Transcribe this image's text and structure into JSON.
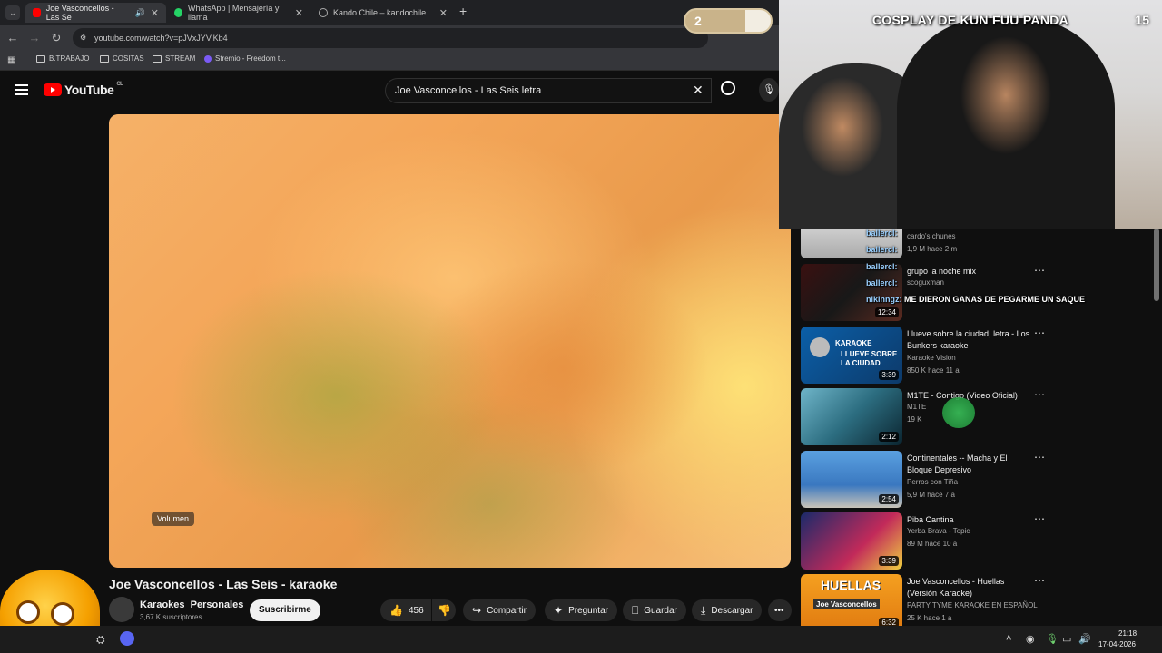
{
  "browser": {
    "tabs": [
      {
        "label": "Joe Vasconcellos - Las Se",
        "active": true
      },
      {
        "label": "WhatsApp | Mensajería y llama",
        "active": false
      },
      {
        "label": "Kando Chile – kandochile",
        "active": false
      }
    ],
    "url": "youtube.com/watch?v=pJVxJYViKb4",
    "bookmarks": [
      "B.TRABAJO",
      "COSITAS",
      "STREAM",
      "Stremio - Freedom t..."
    ]
  },
  "youtube": {
    "logo_text": "YouTube",
    "region": "CL",
    "search_query": "Joe Vasconcellos - Las Seis letra",
    "volume_tooltip": "Volumen",
    "video_title": "Joe Vasconcellos - Las Seis - karaoke",
    "channel_name": "Karaokes_Personales",
    "channel_subs": "3,67 K suscriptores",
    "subscribe_label": "Suscribirme",
    "likes": "456",
    "share_label": "Compartir",
    "ask_label": "Preguntar",
    "save_label": "Guardar",
    "download_label": "Descargar"
  },
  "overlay": {
    "title": "COSPLAY DE KUN FUU PANDA",
    "count": "15",
    "progress_value": "2",
    "chat": [
      {
        "user": "ballercl:",
        "text": ""
      },
      {
        "user": "ballercl:",
        "text": ""
      },
      {
        "user": "ballercl:",
        "text": ""
      },
      {
        "user": "ballercl:",
        "text": ""
      },
      {
        "user": "nikinngz:",
        "text": "ME DIERON GANAS DE PEGARME UN SAQUE"
      }
    ]
  },
  "recommendations": [
    {
      "title": "",
      "channel": "cardo's chunes",
      "meta": "1,9 M  hace 2 m",
      "duration": ""
    },
    {
      "title": "grupo la noche mix",
      "channel": "scoguxman",
      "meta": "",
      "duration": "12:34"
    },
    {
      "title": "Llueve sobre la ciudad, letra - Los Bunkers karaoke",
      "channel": "Karaoke Vision",
      "meta": "850 K  hace 11 a",
      "duration": "3:39"
    },
    {
      "title": "M1TE - Contigo (Video Oficial)",
      "channel": "M1TE",
      "meta": "19 K",
      "duration": "2:12"
    },
    {
      "title": "Continentales -- Macha y El Bloque Depresivo",
      "channel": "Perros con Tiña",
      "meta": "5,9 M  hace 7 a",
      "duration": "2:54"
    },
    {
      "title": "Piba Cantina",
      "channel": "Yerba Brava - Topic",
      "meta": "89 M  hace 10 a",
      "duration": "3:39"
    },
    {
      "title": "Joe Vasconcellos - Huellas (Versión Karaoke)",
      "channel": "PARTY TYME KARAOKE EN ESPAÑOL",
      "meta": "25 K  hace 1 a",
      "duration": "6:32"
    }
  ],
  "thumb_text": {
    "karaoke": "KARAOKE",
    "llueve": "LLUEVE SOBRE LA CIUDAD",
    "huellas": "HUELLAS",
    "huellas_sub": "Joe Vasconcellos"
  },
  "taskbar": {
    "time": "21:18",
    "date": "17-04-2026"
  },
  "colors": {
    "yt_red": "#ff0000",
    "bg": "#0f0f0f",
    "chip": "#272727"
  }
}
